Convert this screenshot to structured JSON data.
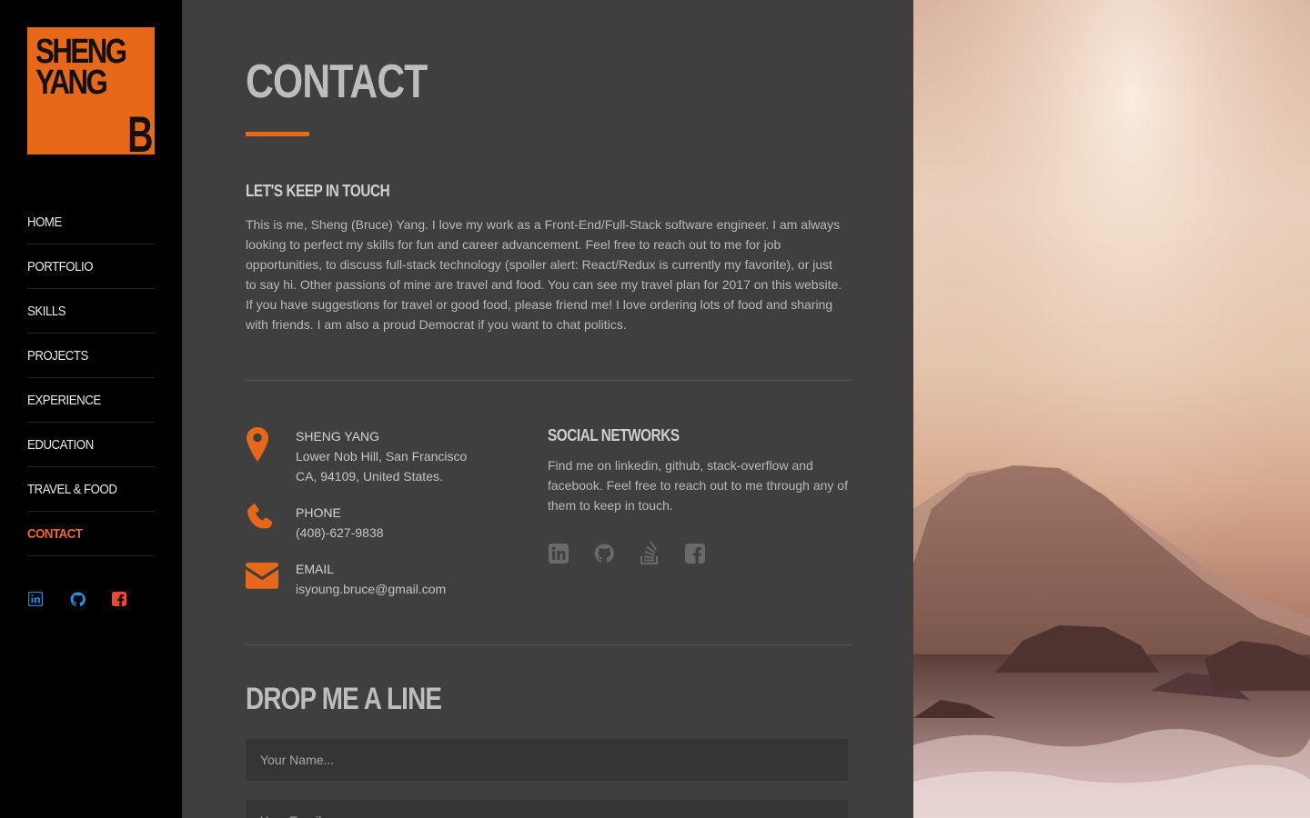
{
  "logo": {
    "line1": "SHENG",
    "line2": "YANG",
    "line3": "B"
  },
  "nav": {
    "items": [
      {
        "label": "HOME"
      },
      {
        "label": "PORTFOLIO"
      },
      {
        "label": "SKILLS"
      },
      {
        "label": "PROJECTS"
      },
      {
        "label": "EXPERIENCE"
      },
      {
        "label": "EDUCATION"
      },
      {
        "label": "TRAVEL & FOOD"
      },
      {
        "label": "CONTACT",
        "active": true
      }
    ],
    "social_icons": [
      "linkedin-icon",
      "github-icon",
      "facebook-icon"
    ]
  },
  "main": {
    "title": "CONTACT",
    "keep_in_touch": {
      "heading": "LET'S KEEP IN TOUCH",
      "body": "This is me, Sheng (Bruce) Yang. I love my work as a Front-End/Full-Stack software engineer. I am always looking to perfect my skills for fun and career advancement. Feel free to reach out to me for job opportunities, to discuss full-stack technology (spoiler alert: React/Redux is currently my favorite), or just to say hi. Other passions of mine are travel and food. You can see my travel plan for 2017 on this website. If you have suggestions for travel or good food, please friend me! I love ordering lots of food and sharing with friends. I am also a proud Democrat if you want to chat politics."
    },
    "address": {
      "name": "SHENG YANG",
      "line1": "Lower Nob Hill, San Francisco",
      "line2": "CA, 94109, United States."
    },
    "phone": {
      "label": "PHONE",
      "value": "(408)-627-9838"
    },
    "email": {
      "label": "EMAIL",
      "value": "isyoung.bruce@gmail.com"
    },
    "social": {
      "heading": "SOCIAL NETWORKS",
      "body": "Find me on linkedin, github, stack-overflow and facebook. Feel free to reach out to me through any of them to keep in touch.",
      "icons": [
        "linkedin-icon",
        "github-icon",
        "stackoverflow-icon",
        "facebook-icon"
      ]
    },
    "form": {
      "title": "DROP ME A LINE",
      "name_placeholder": "Your Name...",
      "email_placeholder": "Your Email..."
    }
  },
  "colors": {
    "accent": "#e8681a",
    "sidebar_bg": "#000000",
    "main_bg": "#3f3f3f",
    "linkedin": "#2a7fd4",
    "github": "#2a8fd4",
    "facebook": "#e8483a"
  }
}
